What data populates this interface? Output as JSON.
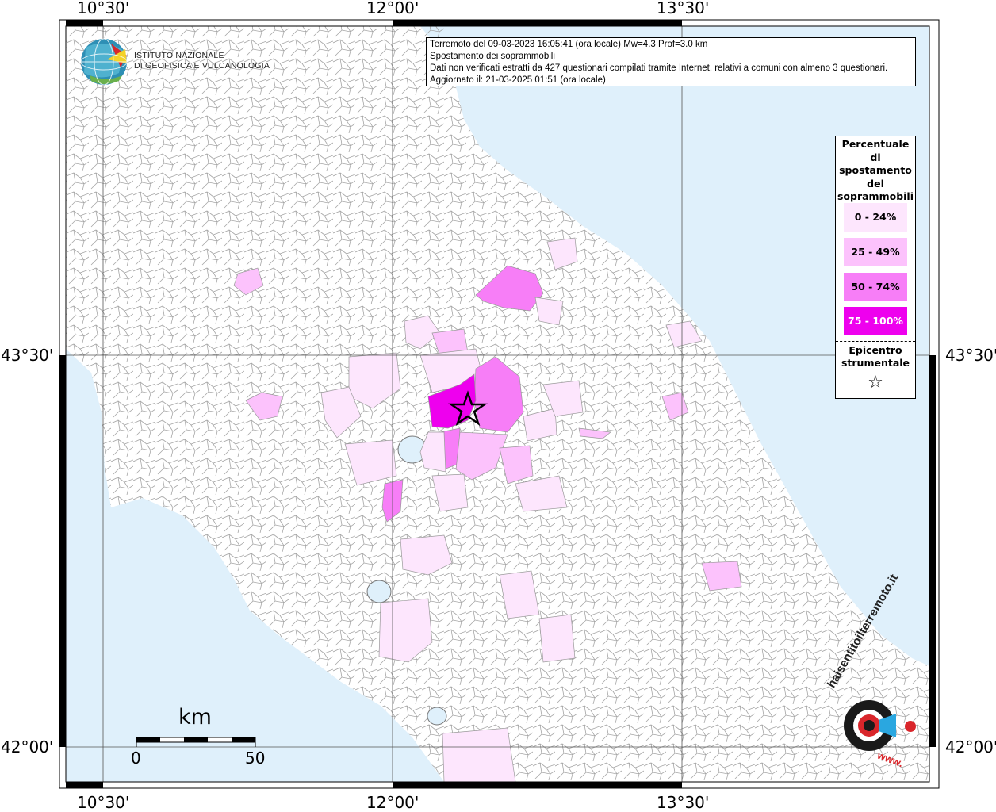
{
  "header": {
    "lines": [
      "Terremoto del 09-03-2023 16:05:41 (ora locale) Mw=4.3 Prof=3.0 km",
      "Spostamento dei soprammobili",
      "Dati non verificati estratti da 427 questionari compilati tramite Internet, relativi a comuni con almeno 3 questionari.",
      "Aggiornato il: 21-03-2025 01:51 (ora locale)"
    ]
  },
  "logo": {
    "line1": "ISTITUTO NAZIONALE",
    "line2": "DI GEOFISICA E VULCANOLOGIA",
    "icon": "globe-icon"
  },
  "axes": {
    "lon_labels": [
      "10°30'",
      "12°00'",
      "13°30'"
    ],
    "lat_labels": [
      "43°30'",
      "42°00'"
    ]
  },
  "legend": {
    "title_lines": [
      "Percentuale",
      "di",
      "spostamento",
      "del",
      "soprammobili"
    ],
    "items": [
      {
        "label": "0 - 24%",
        "color": "#fde6fd"
      },
      {
        "label": "25 - 49%",
        "color": "#fcc2fc"
      },
      {
        "label": "50 - 74%",
        "color": "#f77ef7"
      },
      {
        "label": "75 - 100%",
        "color": "#ee00ee"
      }
    ],
    "epicenter_lines": [
      "Epicentro",
      "strumentale"
    ],
    "epicenter_symbol": "☆"
  },
  "scale": {
    "unit": "km",
    "min_label": "0",
    "max_label": "50"
  },
  "watermark": {
    "brand": "haisentitoilterremoto.it",
    "url": "www.",
    "icon": "target-icon"
  },
  "colors": {
    "sea": "#dff0fb",
    "land": "#ffffff",
    "border": "#9a9a9a"
  }
}
